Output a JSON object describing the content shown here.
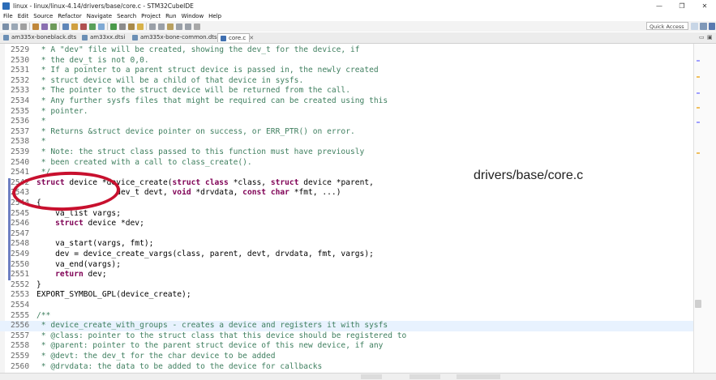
{
  "window": {
    "title": "linux - linux/linux-4.14/drivers/base/core.c - STM32CubeIDE",
    "minimize": "—",
    "maximize": "❐",
    "close": "✕"
  },
  "menu": [
    "File",
    "Edit",
    "Source",
    "Refactor",
    "Navigate",
    "Search",
    "Project",
    "Run",
    "Window",
    "Help"
  ],
  "toolbar": {
    "quick_access": "Quick Access"
  },
  "tabs": [
    {
      "label": "am335x-boneblack.dts",
      "active": false
    },
    {
      "label": "am33xx.dtsi",
      "active": false
    },
    {
      "label": "am335x-bone-common.dtsi",
      "active": false
    },
    {
      "label": "core.c",
      "active": true
    }
  ],
  "tab_close": "✕",
  "annotation": "drivers/base/core.c",
  "code_lines": [
    {
      "n": "2529",
      "text": " * A \"dev\" file will be created, showing the dev_t for the device, if"
    },
    {
      "n": "2530",
      "text": " * the dev_t is not 0,0."
    },
    {
      "n": "2531",
      "text": " * If a pointer to a parent struct device is passed in, the newly created"
    },
    {
      "n": "2532",
      "text": " * struct device will be a child of that device in sysfs."
    },
    {
      "n": "2533",
      "text": " * The pointer to the struct device will be returned from the call."
    },
    {
      "n": "2534",
      "text": " * Any further sysfs files that might be required can be created using this"
    },
    {
      "n": "2535",
      "text": " * pointer."
    },
    {
      "n": "2536",
      "text": " *"
    },
    {
      "n": "2537",
      "text": " * Returns &struct device pointer on success, or ERR_PTR() on error."
    },
    {
      "n": "2538",
      "text": " *"
    },
    {
      "n": "2539",
      "text": " * Note: the struct class passed to this function must have previously"
    },
    {
      "n": "2540",
      "text": " * been created with a call to class_create()."
    },
    {
      "n": "2541",
      "text": " */"
    },
    {
      "n": "2542",
      "text": "struct device *device_create(struct class *class, struct device *parent,"
    },
    {
      "n": "2543",
      "text": "                 dev_t devt, void *drvdata, const char *fmt, ...)"
    },
    {
      "n": "2544",
      "text": "{"
    },
    {
      "n": "2545",
      "text": "    va_list vargs;"
    },
    {
      "n": "2546",
      "text": "    struct device *dev;"
    },
    {
      "n": "2547",
      "text": ""
    },
    {
      "n": "2548",
      "text": "    va_start(vargs, fmt);"
    },
    {
      "n": "2549",
      "text": "    dev = device_create_vargs(class, parent, devt, drvdata, fmt, vargs);"
    },
    {
      "n": "2550",
      "text": "    va_end(vargs);"
    },
    {
      "n": "2551",
      "text": "    return dev;"
    },
    {
      "n": "2552",
      "text": "}"
    },
    {
      "n": "2553",
      "text": "EXPORT_SYMBOL_GPL(device_create);"
    },
    {
      "n": "2554",
      "text": ""
    },
    {
      "n": "2555",
      "text": "/**"
    },
    {
      "n": "2556",
      "text": " * device_create_with_groups - creates a device and registers it with sysfs"
    },
    {
      "n": "2557",
      "text": " * @class: pointer to the struct class that this device should be registered to"
    },
    {
      "n": "2558",
      "text": " * @parent: pointer to the parent struct device of this new device, if any"
    },
    {
      "n": "2559",
      "text": " * @devt: the dev_t for the char device to be added"
    },
    {
      "n": "2560",
      "text": " * @drvdata: the data to be added to the device for callbacks"
    }
  ],
  "colors": {
    "comment": "#3f7f5f",
    "keyword": "#7f0055",
    "annotation_ring": "#c8102e",
    "current_line": "#e8f2fe"
  }
}
